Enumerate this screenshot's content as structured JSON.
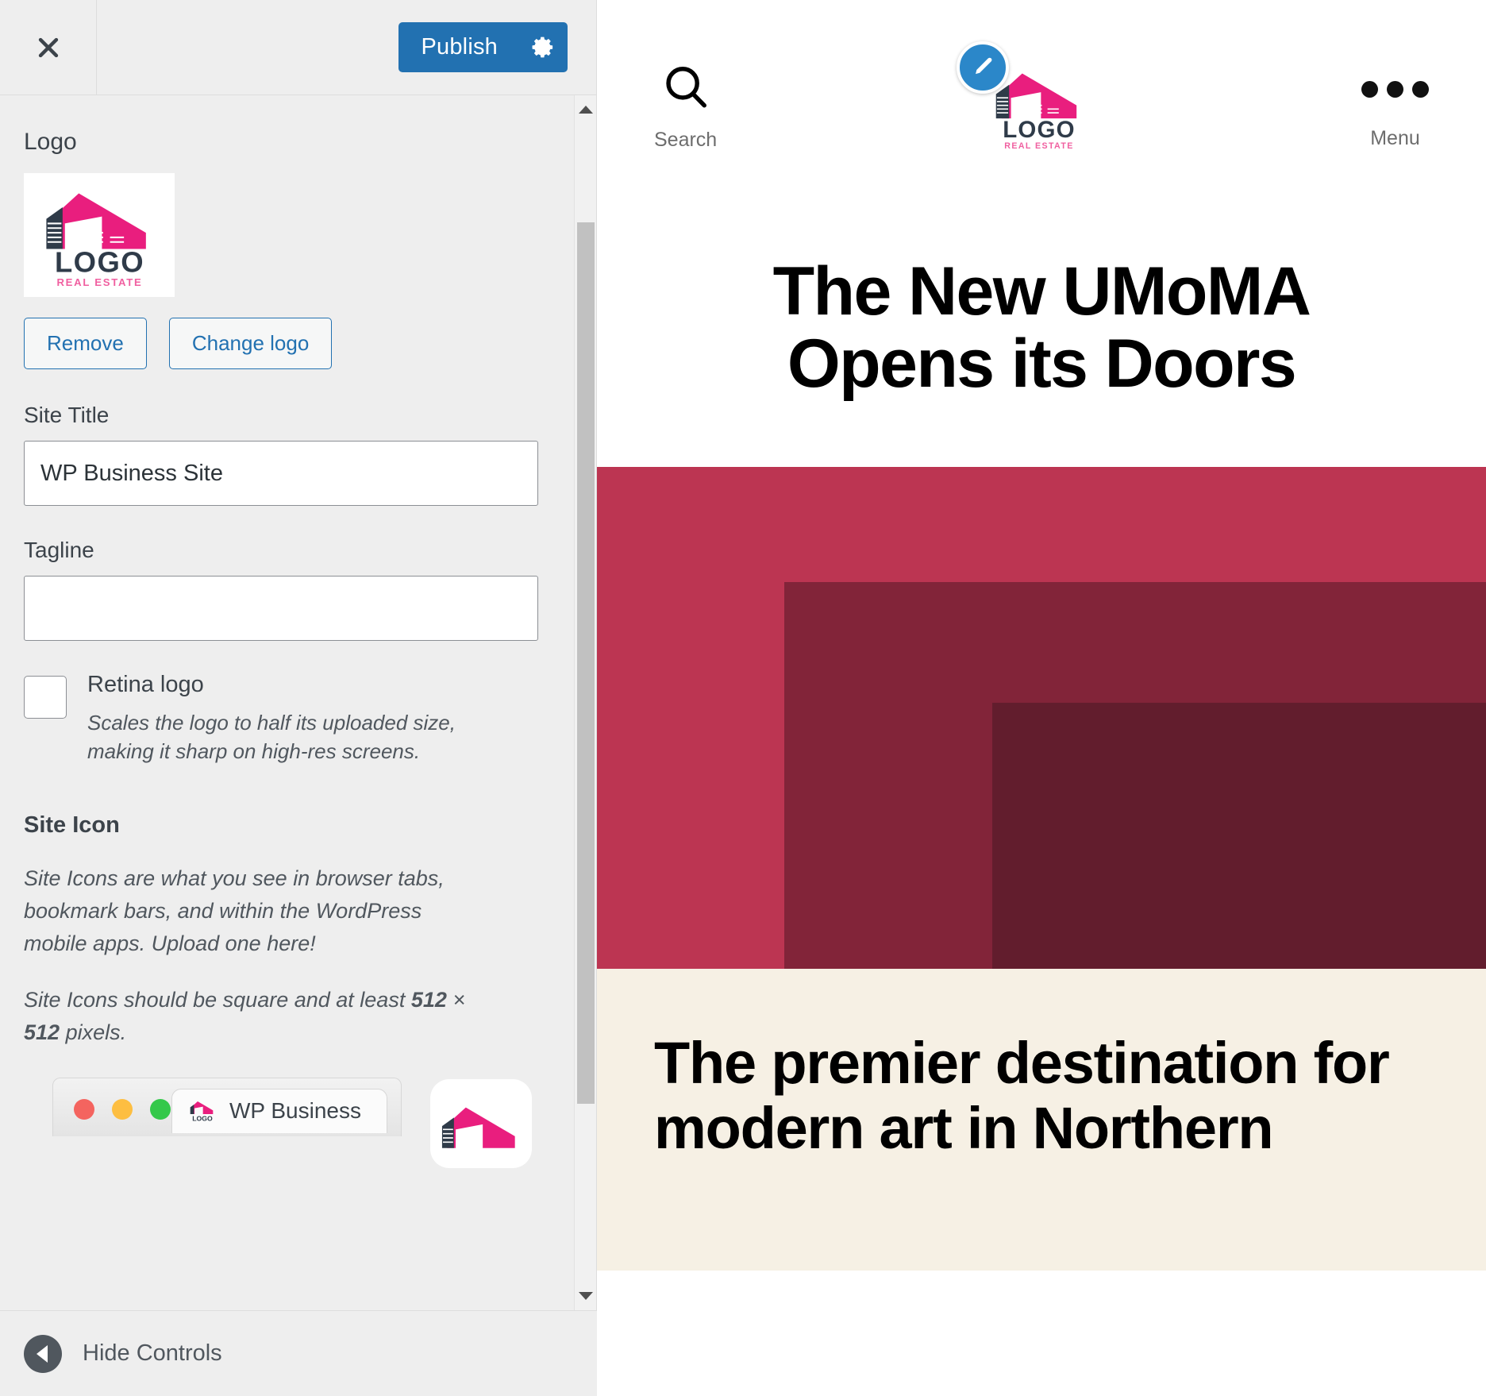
{
  "customizer": {
    "close_icon": "close-icon",
    "publish_label": "Publish",
    "gear_icon": "gear-icon",
    "hide_controls_label": "Hide Controls",
    "back_arrow_icon": "chevron-left-icon",
    "scroll_up_icon": "caret-up-icon",
    "scroll_down_icon": "caret-down-icon",
    "accent_color": "#2271b1"
  },
  "logo_section": {
    "title": "Logo",
    "thumbnail_alt": "LOGO REAL ESTATE",
    "remove_label": "Remove",
    "change_label": "Change logo"
  },
  "site_title_field": {
    "label": "Site Title",
    "value": "WP Business Site",
    "placeholder": ""
  },
  "tagline_field": {
    "label": "Tagline",
    "value": "",
    "placeholder": ""
  },
  "retina": {
    "label": "Retina logo",
    "checked": false,
    "description": "Scales the logo to half its uploaded size, making it sharp on high-res screens."
  },
  "site_icon": {
    "heading": "Site Icon",
    "paragraph_1": "Site Icons are what you see in browser tabs, bookmark bars, and within the WordPress mobile apps. Upload one here!",
    "paragraph_2_pre": "Site Icons should be square and at least ",
    "paragraph_2_bold_a": "512",
    "paragraph_2_mid": " × ",
    "paragraph_2_bold_b": "512",
    "paragraph_2_post": " pixels."
  },
  "browser_preview": {
    "tab_title": "WP Business",
    "dot_red": "#f4645f",
    "dot_yellow": "#fdbe41",
    "dot_green": "#34c84a"
  },
  "site_preview": {
    "search_label": "Search",
    "search_icon": "search-icon",
    "menu_label": "Menu",
    "menu_icon": "ellipsis-icon",
    "logo_alt": "LOGO REAL ESTATE",
    "edit_badge_icon": "pencil-edit-icon",
    "hero_title": "The New UMoMA Opens its Doors",
    "cream_text": "The premier destination for modern art in Northern",
    "art_colors": {
      "outer": "#bc3552",
      "middle": "#822439",
      "inner": "#621d2d"
    },
    "cream_bg": "#f6f0e4",
    "logo_pink": "#e91e7e"
  }
}
